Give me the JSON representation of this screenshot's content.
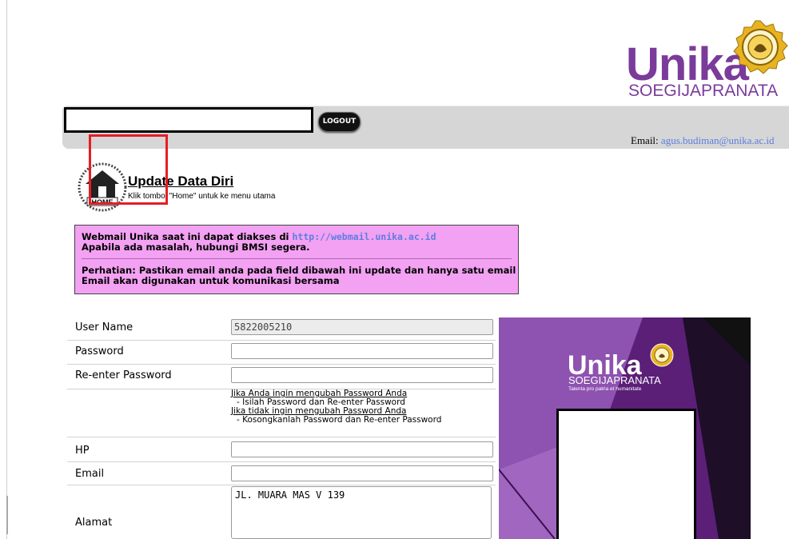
{
  "header": {
    "logo_main": "Unika",
    "logo_sub": "SOEGIJAPRANATA",
    "logout_label": "LOGOUT",
    "email_label": "Email:",
    "email_value": "agus.budiman@unika.ac.id"
  },
  "home": {
    "icon_label": "HOME",
    "title": "Update Data Diri",
    "hint": "Klik tombol \"Home\" untuk ke menu utama"
  },
  "notice": {
    "line1_prefix": "Webmail Unika saat ini dapat diakses di ",
    "line1_link": "http://webmail.unika.ac.id",
    "line2": "Apabila ada masalah, hubungi BMSI segera.",
    "line3": "Perhatian: Pastikan email anda pada field dibawah ini update dan hanya satu email",
    "line4": "Email akan digunakan untuk komunikasi bersama"
  },
  "form": {
    "username_label": "User Name",
    "username_value": "5822005210",
    "password_label": "Password",
    "password_value": "",
    "reenter_label": "Re-enter Password",
    "reenter_value": "",
    "help1": "Jika Anda ingin mengubah Password Anda",
    "help2": "- Isilah Password dan Re-enter Password",
    "help3": "Jika tidak ingin mengubah Password Anda",
    "help4": "- Kosongkanlah Password dan Re-enter Password",
    "hp_label": "HP",
    "hp_value": "",
    "email_label": "Email",
    "email_value": "",
    "alamat_label": "Alamat",
    "alamat_value": "JL. MUARA MAS V 139"
  },
  "card": {
    "logo_main": "Unika",
    "logo_sub": "SOEGIJAPRANATA",
    "tagline": "Talenta pro patria et humanitate"
  },
  "colors": {
    "brand_purple": "#7a3b9a",
    "notice_bg": "#f3a1f3",
    "link_blue": "#5c7ee0",
    "highlight_red": "#e81c24"
  }
}
